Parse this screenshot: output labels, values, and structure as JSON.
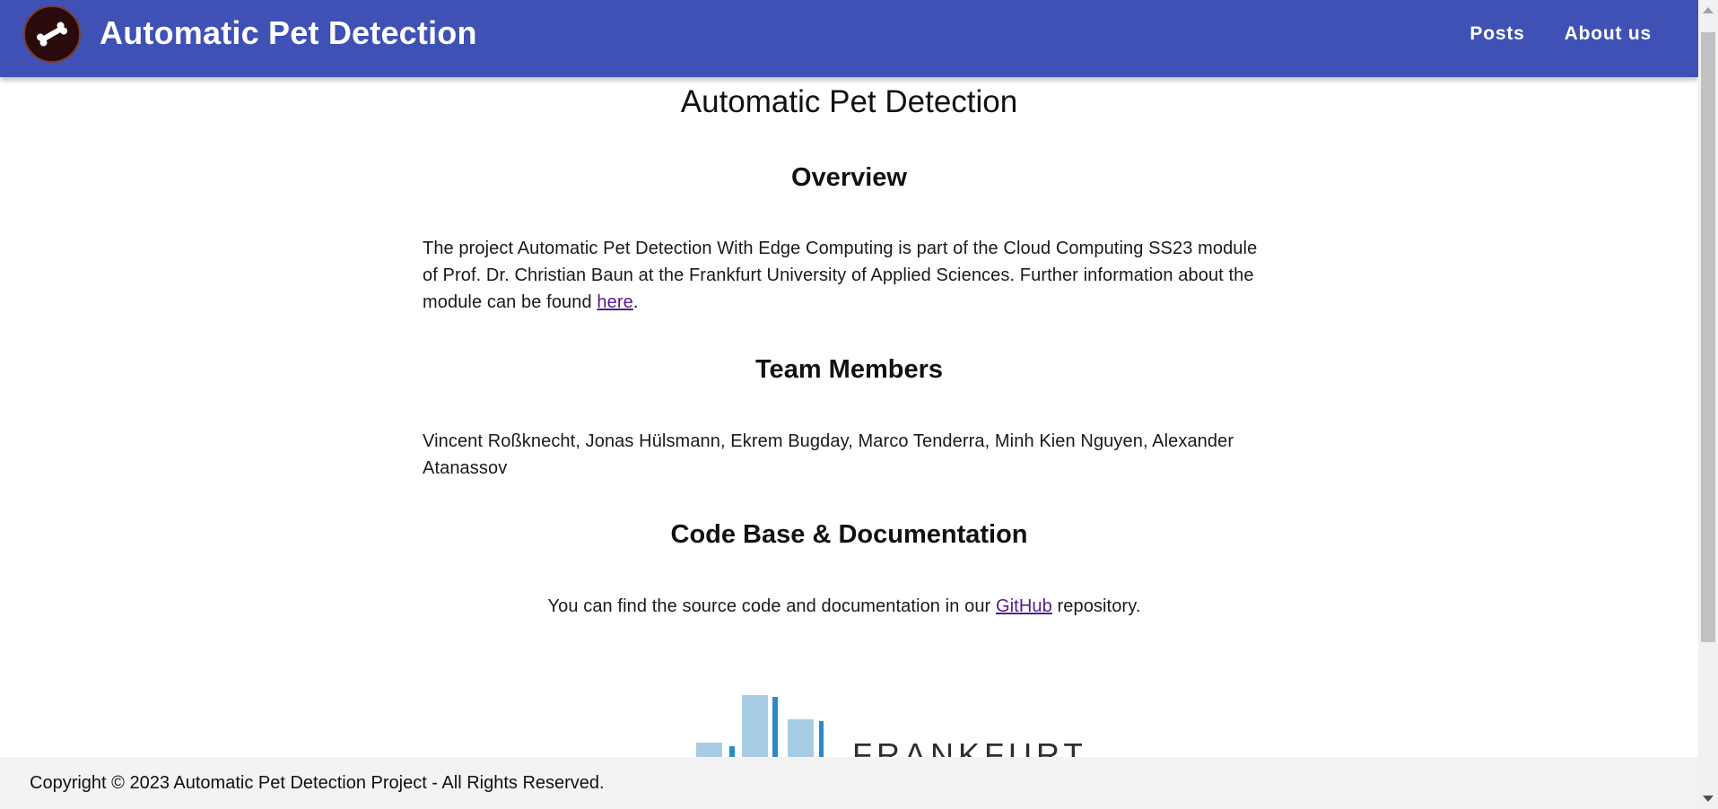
{
  "header": {
    "brand": "Automatic Pet Detection",
    "logo_icon": "bone-icon",
    "nav": [
      {
        "label": "Posts"
      },
      {
        "label": "About us"
      }
    ]
  },
  "main": {
    "title": "Automatic Pet Detection",
    "overview": {
      "heading": "Overview",
      "text_before": "The project Automatic Pet Detection With Edge Computing is part of the Cloud Computing SS23 module of Prof. Dr. Christian Baun at the Frankfurt University of Applied Sciences. Further information about the module can be found ",
      "link": "here",
      "text_after": "."
    },
    "team": {
      "heading": "Team Members",
      "members": "Vincent Roßknecht, Jonas Hülsmann, Ekrem Bugday, Marco Tenderra, Minh Kien Nguyen, Alexander Atanassov"
    },
    "code": {
      "heading": "Code Base & Documentation",
      "text_before": "You can find the source code and documentation in our ",
      "link": "GitHub",
      "text_after": " repository."
    },
    "university_logo": {
      "text": "FRANKFURT",
      "color": "#a9cce6",
      "accent": "#2b8bc6"
    }
  },
  "footer": {
    "copyright": "Copyright © 2023 Automatic Pet Detection Project - All Rights Reserved."
  },
  "colors": {
    "header_bg": "#3f51b5",
    "link": "#551a8b",
    "footer_bg": "#f3f3f3"
  }
}
